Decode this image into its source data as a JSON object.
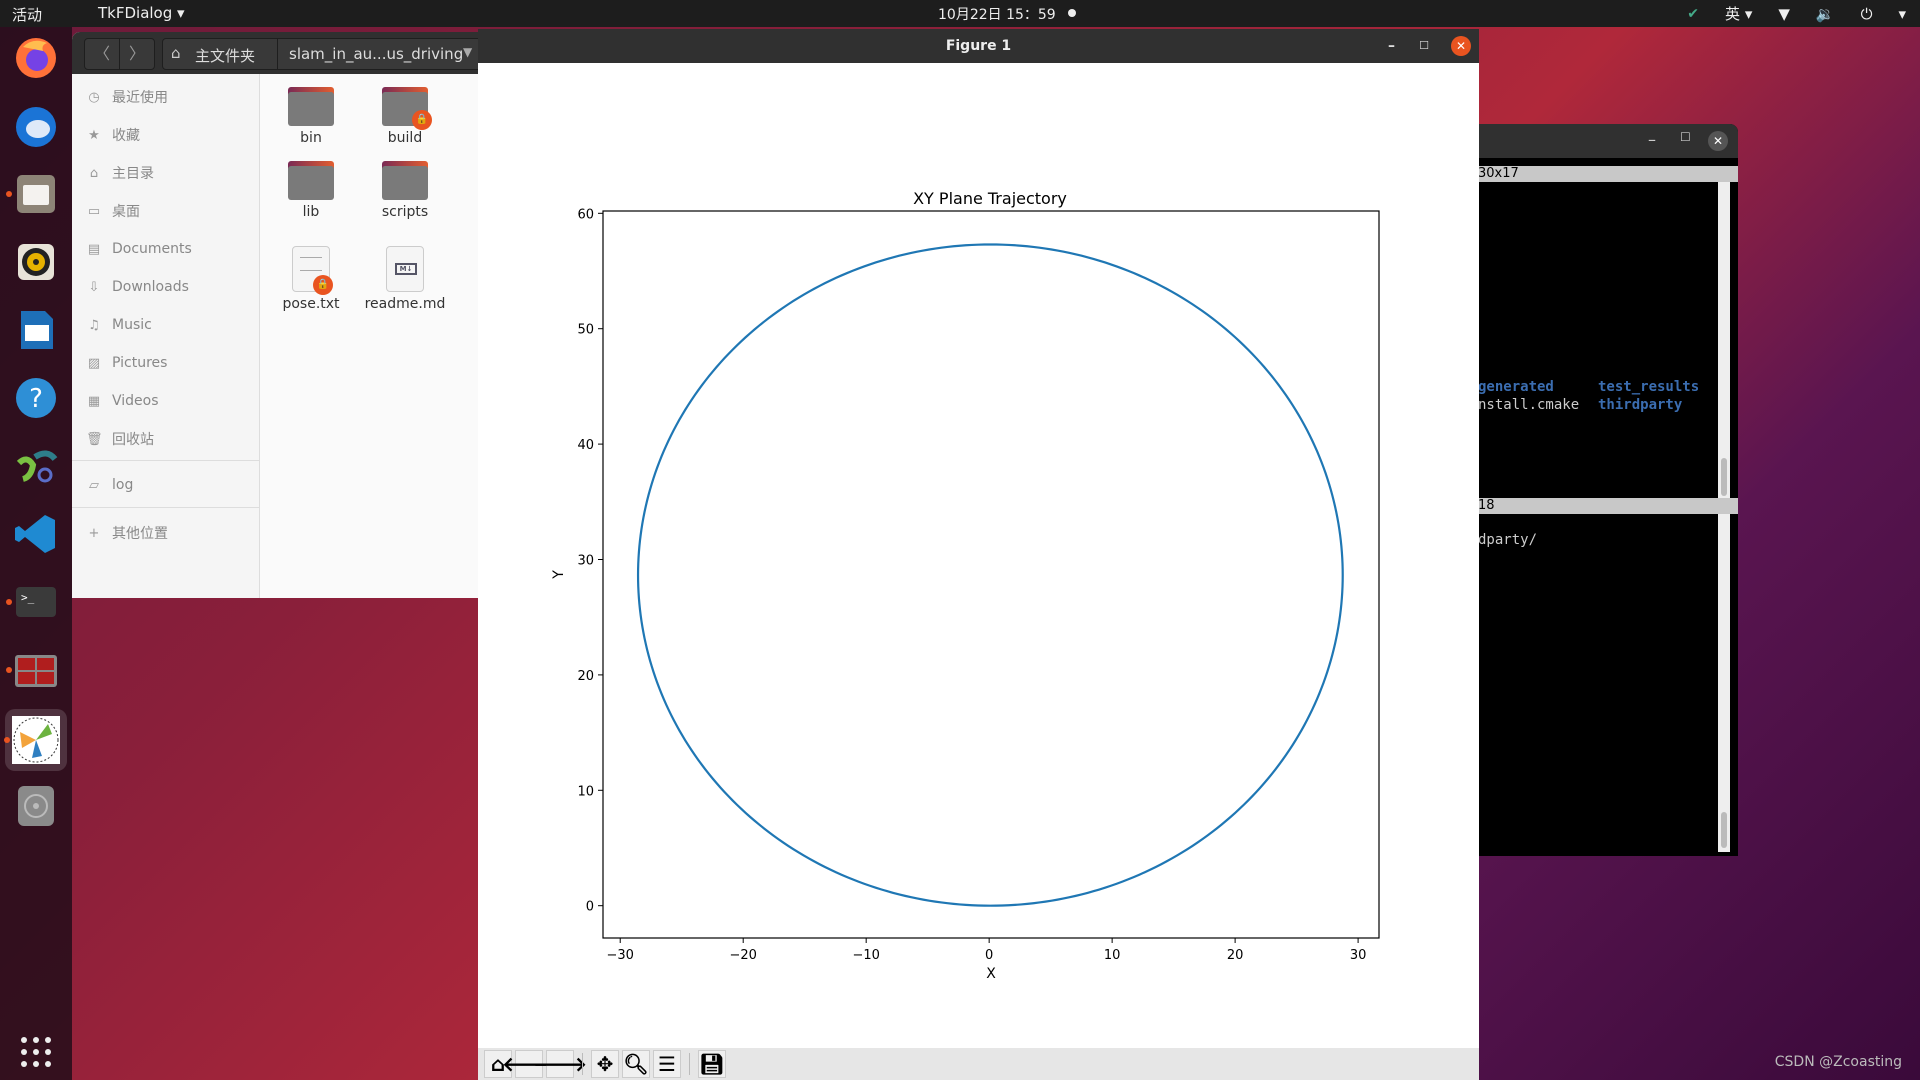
{
  "topbar": {
    "activities": "活动",
    "app_menu": "TkFDialog ▾",
    "clock": "10月22日  15：59",
    "input_method": "英",
    "icons": [
      "app-indicator-icon",
      "wifi-icon",
      "volume-icon",
      "power-icon",
      "chevron-down-icon"
    ]
  },
  "dock": {
    "items": [
      {
        "name": "firefox",
        "running": false
      },
      {
        "name": "thunderbird",
        "running": false
      },
      {
        "name": "files",
        "running": true
      },
      {
        "name": "rhythmbox",
        "running": false
      },
      {
        "name": "libreoffice-writer",
        "running": false
      },
      {
        "name": "help",
        "running": false
      },
      {
        "name": "inkscape",
        "running": false
      },
      {
        "name": "vscode",
        "running": false
      },
      {
        "name": "terminal",
        "running": true
      },
      {
        "name": "terminator",
        "running": true
      },
      {
        "name": "tk-figure",
        "running": true
      },
      {
        "name": "disc",
        "running": false
      }
    ],
    "apps_grid": "show-applications"
  },
  "files": {
    "back": "〈",
    "forward": "〉",
    "home_label": "主文件夹",
    "current": "slam_in_au...us_driving",
    "sidebar": [
      {
        "label": "最近使用",
        "icon": "clock-icon"
      },
      {
        "label": "收藏",
        "icon": "star-icon"
      },
      {
        "label": "主目录",
        "icon": "home-icon"
      },
      {
        "label": "桌面",
        "icon": "desktop-icon"
      },
      {
        "label": "Documents",
        "icon": "document-icon"
      },
      {
        "label": "Downloads",
        "icon": "download-icon"
      },
      {
        "label": "Music",
        "icon": "music-icon"
      },
      {
        "label": "Pictures",
        "icon": "picture-icon"
      },
      {
        "label": "Videos",
        "icon": "video-icon"
      },
      {
        "label": "回收站",
        "icon": "trash-icon"
      },
      {
        "label": "log",
        "icon": "folder-icon"
      },
      {
        "label": "其他位置",
        "icon": "plus-icon"
      }
    ],
    "items": [
      {
        "name": "bin",
        "type": "folder",
        "locked": false
      },
      {
        "name": "build",
        "type": "folder",
        "locked": true
      },
      {
        "name": "lib",
        "type": "folder",
        "locked": false
      },
      {
        "name": "scripts",
        "type": "folder",
        "locked": false
      },
      {
        "name": "pose.txt",
        "type": "text",
        "locked": true
      },
      {
        "name": "readme.md",
        "type": "markdown",
        "locked": false
      }
    ]
  },
  "figure": {
    "window_title": "Figure 1",
    "toolbar": [
      "home",
      "back",
      "forward",
      "pan",
      "zoom",
      "configure",
      "save"
    ]
  },
  "terminal": {
    "pane1_title": "30x17",
    "pane1_line1_a": "generated",
    "pane1_line1_b": "test_results",
    "pane1_line2_a": "nstall.cmake",
    "pane1_line2_b": "thirdparty",
    "pane2_title": "18",
    "pane2_line1": "dparty/"
  },
  "watermark": "CSDN @Zcoasting",
  "chart_data": {
    "type": "line",
    "title": "XY Plane Trajectory",
    "xlabel": "X",
    "ylabel": "Y",
    "xlim": [
      -31.4,
      31.7
    ],
    "ylim": [
      -2.8,
      60.2
    ],
    "xticks": [
      -30,
      -20,
      -10,
      0,
      10,
      20,
      30
    ],
    "xtick_labels": [
      "−30",
      "−20",
      "−10",
      "0",
      "10",
      "20",
      "30"
    ],
    "yticks": [
      0,
      10,
      20,
      30,
      40,
      50,
      60
    ],
    "ytick_labels": [
      "0",
      "10",
      "20",
      "30",
      "40",
      "50",
      "60"
    ],
    "grid": false,
    "series": [
      {
        "name": "trajectory",
        "color": "#1f77b4",
        "shape": "circle",
        "center": [
          0.1,
          28.65
        ],
        "radius": 28.65,
        "description": "closed circular path starting/ending near (0,0)"
      }
    ]
  }
}
